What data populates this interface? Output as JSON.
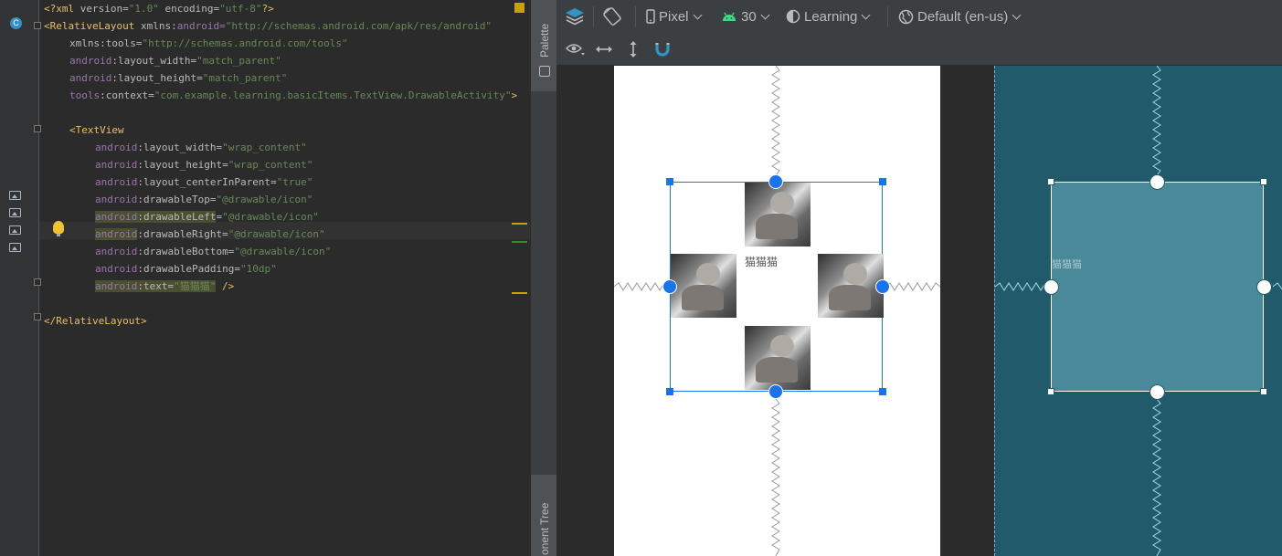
{
  "editor": {
    "lines": [
      {
        "tag_open": "<?xml ",
        "attr1": "version=",
        "val1": "\"1.0\" ",
        "attr2": "encoding=",
        "val2": "\"utf-8\"",
        "tag_close": "?>"
      },
      {
        "tag": "<RelativeLayout ",
        "ns": "xmlns:",
        "attr": "android=",
        "val": "\"http://schemas.android.com/apk/res/android\""
      },
      {
        "attr": "xmlns:tools=",
        "val": "\"http://schemas.android.com/tools\""
      },
      {
        "ns": "android",
        "attr": ":layout_width=",
        "val": "\"match_parent\""
      },
      {
        "ns": "android",
        "attr": ":layout_height=",
        "val": "\"match_parent\""
      },
      {
        "ns": "tools",
        "attr": ":context=",
        "val": "\"com.example.learning.basicItems.TextView.DrawableActivity\"",
        "close": ">"
      },
      {
        "text": ""
      },
      {
        "tag": "<TextView"
      },
      {
        "ns": "android",
        "attr": ":layout_width=",
        "val": "\"wrap_content\""
      },
      {
        "ns": "android",
        "attr": ":layout_height=",
        "val": "\"wrap_content\""
      },
      {
        "ns": "android",
        "attr": ":layout_centerInParent=",
        "val": "\"true\""
      },
      {
        "ns": "android",
        "attr": ":drawableTop=",
        "val": "\"@drawable/icon\""
      },
      {
        "ns": "android",
        "attr": ":drawableLeft",
        "rest": "=",
        "val": "\"@drawable/icon\""
      },
      {
        "ns": "android",
        "attr": ":drawableRight",
        "rest": "=",
        "val": "\"@drawable/icon\""
      },
      {
        "ns": "android",
        "attr": ":drawableBottom=",
        "val": "\"@drawable/icon\""
      },
      {
        "ns": "android",
        "attr": ":drawablePadding=",
        "val": "\"10dp\""
      },
      {
        "ns": "android",
        "attr": ":text=",
        "val": "\"猫猫猫\"",
        "close": " />"
      },
      {
        "text": ""
      },
      {
        "tag": "</RelativeLayout>"
      }
    ]
  },
  "side_tabs": {
    "palette": "Palette",
    "component_tree": "onent Tree"
  },
  "toolbar": {
    "device": "Pixel",
    "api_level": "30",
    "theme": "Learning",
    "locale": "Default (en-us)"
  },
  "canvas": {
    "text_view_label": "猫猫猫",
    "blueprint_label": "猫猫猫"
  },
  "colors": {
    "selection": "#1a73e8",
    "blueprint_bg": "#215a6a",
    "design_bg": "#ffffff"
  }
}
